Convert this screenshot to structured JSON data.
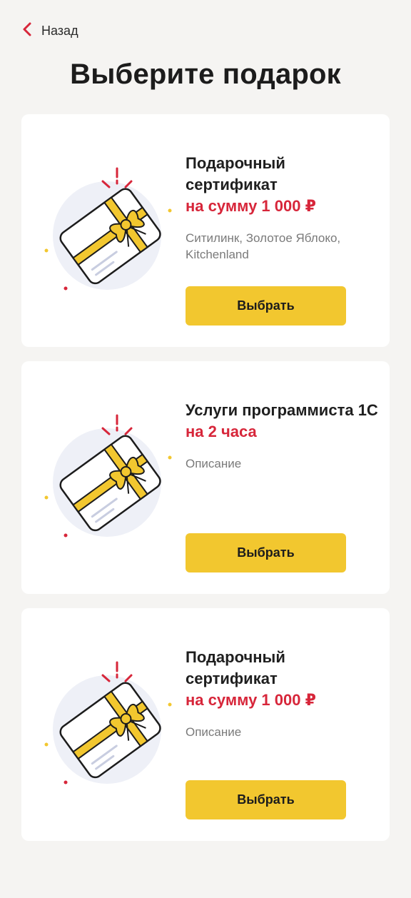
{
  "nav": {
    "back_label": "Назад"
  },
  "page": {
    "title": "Выберите подарок"
  },
  "colors": {
    "accent": "#f2c72f",
    "price": "#d7263a",
    "background": "#f5f4f2"
  },
  "gifts": [
    {
      "name": "Подарочный сертификат",
      "value": "на сумму 1 000 ₽",
      "description": "Ситилинк, Золотое Яблоко, Kitchenland",
      "button_label": "Выбрать",
      "icon": "gift-card-icon"
    },
    {
      "name": "Услуги программиста 1С",
      "value": "на 2 часа",
      "description": "Описание",
      "button_label": "Выбрать",
      "icon": "gift-card-icon"
    },
    {
      "name": "Подарочный сертификат",
      "value": "на сумму 1 000 ₽",
      "description": "Описание",
      "button_label": "Выбрать",
      "icon": "gift-card-icon"
    }
  ]
}
